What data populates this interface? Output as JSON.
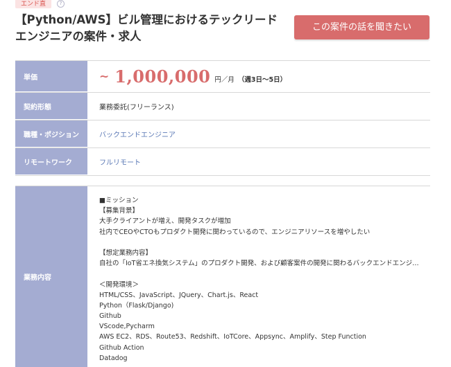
{
  "badge": "エンド直",
  "help_icon_glyph": "?",
  "job_title": "【Python/AWS】ビル管理におけるテックリードエンジニアの案件・求人",
  "cta_button": "この案件の話を聞きたい",
  "details": {
    "price": {
      "label": "単価",
      "tilde": "~",
      "amount": "1,000,000",
      "unit": "円／月",
      "days": "（週3日〜5日）"
    },
    "contract": {
      "label": "契約形態",
      "value": "業務委託(フリーランス)"
    },
    "role": {
      "label": "職種・ポジション",
      "value": "バックエンドエンジニア"
    },
    "remote": {
      "label": "リモートワーク",
      "value": "フルリモート"
    }
  },
  "description": {
    "label": "業務内容",
    "lines": [
      "■ミッション",
      "【募集背景】",
      "大手クライアントが増え、開発タスクが増加",
      "社内でCEOやCTOもプロダクト開発に関わっているので、エンジニアリソースを増やしたい",
      "",
      "【想定業務内容】",
      "自社の「IoT省エネ換気システム」のプロダクト開発、および顧客案件の開発に関わるバックエンドエンジニアと…",
      "",
      "＜開発環境＞",
      "HTML/CSS、JavaScript、JQuery、Chart.js、React",
      "Python（Flask/Django)",
      "Github",
      "VScode,Pycharm",
      "AWS EC2、RDS、Route53、Redshift、IoTCore、Appsync、Amplify、Step Function",
      "Github Action",
      "Datadog"
    ]
  },
  "colors": {
    "accent": "#d86c6c",
    "label_bg": "#a4acd2",
    "link": "#5a78b5"
  }
}
